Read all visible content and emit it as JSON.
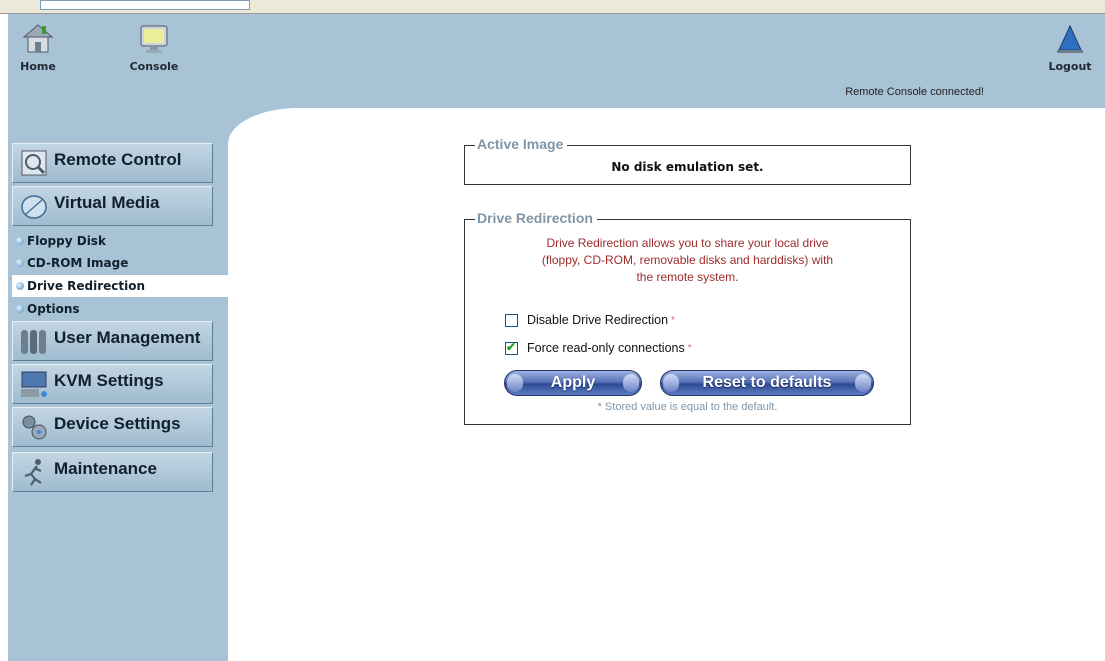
{
  "header": {
    "home_label": "Home",
    "console_label": "Console",
    "logout_label": "Logout",
    "status": "Remote Console connected!"
  },
  "sidebar": {
    "sections": [
      {
        "label": "Remote Control",
        "icon": "magnifier-icon"
      },
      {
        "label": "Virtual Media",
        "icon": "disk-icon"
      },
      {
        "label": "User Management",
        "icon": "users-icon"
      },
      {
        "label": "KVM Settings",
        "icon": "keyboard-monitor-icon"
      },
      {
        "label": "Device Settings",
        "icon": "gears-icon"
      },
      {
        "label": "Maintenance",
        "icon": "runner-icon"
      }
    ],
    "virtual_media_items": [
      {
        "label": "Floppy Disk",
        "active": false
      },
      {
        "label": "CD-ROM Image",
        "active": false
      },
      {
        "label": "Drive Redirection",
        "active": true
      },
      {
        "label": "Options",
        "active": false
      }
    ]
  },
  "active_image": {
    "legend": "Active Image",
    "text": "No disk emulation set."
  },
  "drive_redirection": {
    "legend": "Drive Redirection",
    "info_line1": "Drive Redirection allows you to share your local drive",
    "info_line2": "(floppy, CD-ROM, removable disks and harddisks) with",
    "info_line3": "the remote system.",
    "disable_label": "Disable Drive Redirection",
    "disable_checked": false,
    "readonly_label": "Force read-only connections",
    "readonly_checked": true,
    "star": "*",
    "apply_label": "Apply",
    "reset_label": "Reset to defaults",
    "footnote": "* Stored value is equal to the default."
  },
  "colors": {
    "frame_bg": "#a9c3d6",
    "legend_text": "#7f96a8",
    "info_text": "#a02c2c",
    "button_blue": "#2e4a94"
  }
}
